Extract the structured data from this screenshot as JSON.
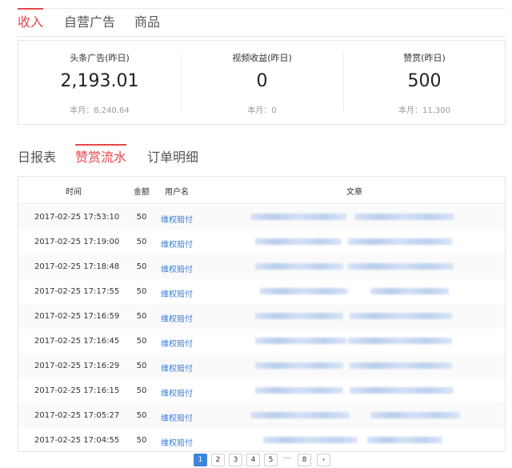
{
  "top_tabs": [
    {
      "label": "收入",
      "active": true
    },
    {
      "label": "自营广告",
      "active": false
    },
    {
      "label": "商品",
      "active": false
    }
  ],
  "stats": [
    {
      "label": "头条广告(昨日)",
      "value": "2,193.01",
      "month": "本月：8,240.64"
    },
    {
      "label": "视频收益(昨日)",
      "value": "0",
      "month": "本月：0"
    },
    {
      "label": "赞赏(昨日)",
      "value": "500",
      "month": "本月：11,300"
    }
  ],
  "sub_tabs": [
    {
      "label": "日报表",
      "active": false
    },
    {
      "label": "赞赏流水",
      "active": true
    },
    {
      "label": "订单明细",
      "active": false
    }
  ],
  "table": {
    "headers": [
      "时间",
      "金额",
      "用户名",
      "文章"
    ],
    "rows": [
      {
        "time": "2017-02-25 17:53:10",
        "amount": "50",
        "user": "维权赔付"
      },
      {
        "time": "2017-02-25 17:19:00",
        "amount": "50",
        "user": "维权赔付"
      },
      {
        "time": "2017-02-25 17:18:48",
        "amount": "50",
        "user": "维权赔付"
      },
      {
        "time": "2017-02-25 17:17:55",
        "amount": "50",
        "user": "维权赔付"
      },
      {
        "time": "2017-02-25 17:16:59",
        "amount": "50",
        "user": "维权赔付"
      },
      {
        "time": "2017-02-25 17:16:45",
        "amount": "50",
        "user": "维权赔付"
      },
      {
        "time": "2017-02-25 17:16:29",
        "amount": "50",
        "user": "维权赔付"
      },
      {
        "time": "2017-02-25 17:16:15",
        "amount": "50",
        "user": "维权赔付"
      },
      {
        "time": "2017-02-25 17:05:27",
        "amount": "50",
        "user": "维权赔付"
      },
      {
        "time": "2017-02-25 17:04:55",
        "amount": "50",
        "user": "维权赔付"
      }
    ]
  },
  "pagination": {
    "pages": [
      "1",
      "2",
      "3",
      "4",
      "5"
    ],
    "current": "1",
    "ellipsis": "···",
    "last": "8",
    "next_icon": "chevron-right-icon",
    "next_glyph": "›"
  },
  "colors": {
    "accent": "#e8454a",
    "link": "#3a7bd5",
    "pager_active": "#3c86d8"
  }
}
